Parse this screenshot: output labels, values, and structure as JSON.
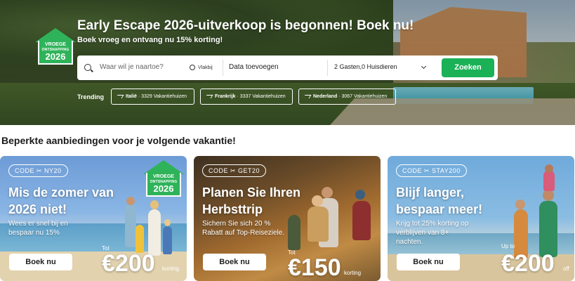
{
  "hero": {
    "badge": {
      "line1": "VROEGE",
      "line2": "ONTSNAPPING",
      "year": "2026"
    },
    "title": "Early Escape 2026-uitverkoop is begonnen! Boek nu!",
    "subtitle": "Boek vroeg en ontvang nu 15% korting!",
    "search": {
      "where_placeholder": "Waar wil je naartoe?",
      "nearby_label": "Vlakbij",
      "dates_label": "Data toevoegen",
      "guests_label": "2 Gasten,0 Huisdieren",
      "submit_label": "Zoeken"
    },
    "trending": {
      "label": "Trending",
      "items": [
        {
          "country": "Italië",
          "count": "· 3329 Vakantiehuizen"
        },
        {
          "country": "Frankrijk",
          "count": "· 3337 Vakantiehuizen"
        },
        {
          "country": "Nederland",
          "count": "· 3067 Vakantiehuizen"
        }
      ]
    }
  },
  "section": {
    "title": "Beperkte aanbiedingen voor je volgende vakantie!"
  },
  "cards": [
    {
      "code": "CODE ✂ NY20",
      "heading_line1": "Mis de zomer van",
      "heading_line2": "2026 niet!",
      "text_line1": "Wees er snel bij en",
      "text_line2": "bespaar nu 15%",
      "badge": {
        "line1": "VROEGE",
        "line2": "ONTSNAPPING",
        "year": "2026"
      },
      "prefix": "Tot",
      "amount": "€200",
      "suffix": "korting",
      "button": "Boek nu"
    },
    {
      "code": "CODE ✂ GET20",
      "heading_line1": "Planen Sie Ihren",
      "heading_line2": "Herbsttrip",
      "text_line1": "Sichern Sie sich 20 %",
      "text_line2": "Rabatt auf Top-Reiseziele.",
      "prefix": "Tot",
      "amount": "€150",
      "suffix": "korting",
      "button": "Boek nu"
    },
    {
      "code": "CODE ✂ STAY200",
      "heading_line1": "Blijf langer,",
      "heading_line2": "bespaar meer!",
      "text_line1": "Krijg tot 25% korting op",
      "text_line2": "verblijven van 8+",
      "text_line3": "nachten.",
      "prefix": "Up to",
      "amount": "€200",
      "suffix": "off",
      "button": "Boek nu"
    }
  ]
}
